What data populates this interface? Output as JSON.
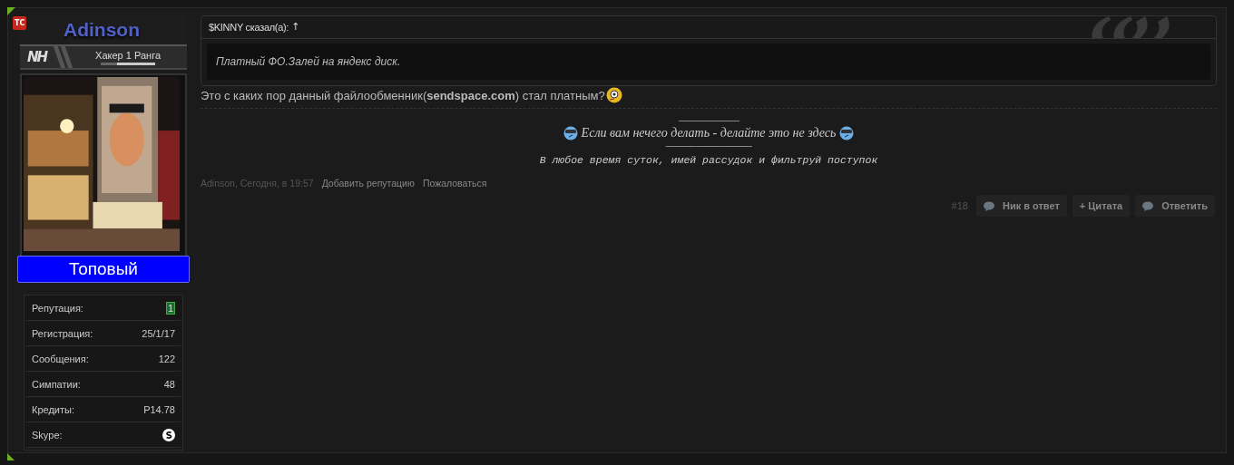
{
  "user": {
    "badge": "TC",
    "name": "Adinson",
    "rank_logo": "NH",
    "rank": "Хакер 1 Ранга",
    "rank_meter": {
      "level": 0.3
    },
    "title": "Топовый",
    "stats": [
      {
        "label": "Репутация:",
        "kind": "highlight",
        "value": "1"
      },
      {
        "label": "Регистрация:",
        "kind": "text",
        "value": "25/1/17"
      },
      {
        "label": "Сообщения:",
        "kind": "text",
        "value": "122"
      },
      {
        "label": "Симпатии:",
        "kind": "text",
        "value": "48"
      },
      {
        "label": "Кредиты:",
        "kind": "text",
        "value": "Р14.78"
      },
      {
        "label": "Skype:",
        "kind": "skype"
      }
    ]
  },
  "post": {
    "quote": {
      "author": "$KINNY сказал(а):",
      "jump": "↑",
      "text": "Платный ФО.Залей на яндекс диск."
    },
    "message": "Это с каких пор данный файлообменник(**sendspace.com**) стал платным?",
    "signature": [
      {
        "kind": "rule",
        "text": "--------------------------------------"
      },
      {
        "kind": "motto",
        "text": "Если вам нечего делать - делайте это не здесь"
      },
      {
        "kind": "rule",
        "text": "------------------------------------------------------"
      },
      {
        "kind": "mono",
        "text": "В любое время суток, имей рассудок и фильтруй поступок"
      }
    ],
    "meta": {
      "byline": "Adinson, Сегодня, в 19:57",
      "links": [
        "Добавить репутацию",
        "Пожаловаться"
      ]
    },
    "number": "#18",
    "buttons": [
      {
        "kind": "bubble",
        "label": "Ник в ответ"
      },
      {
        "kind": "plain",
        "label": "+ Цитата"
      },
      {
        "kind": "bubble",
        "label": "Ответить"
      }
    ]
  }
}
